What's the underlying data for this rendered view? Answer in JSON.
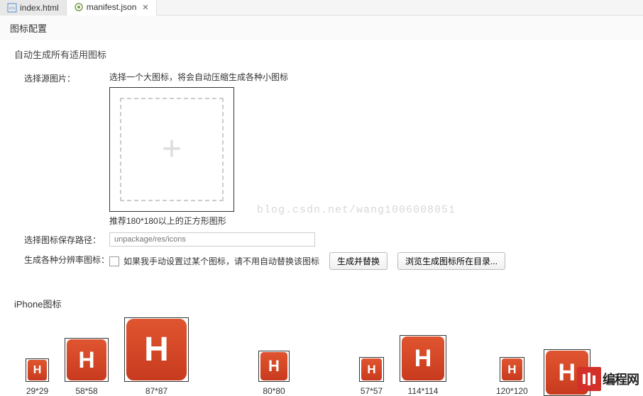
{
  "tabs": {
    "index": "index.html",
    "manifest": "manifest.json"
  },
  "section": {
    "title": "图标配置"
  },
  "group": {
    "autoGenerate": "自动生成所有适用图标"
  },
  "sourceImage": {
    "label": "选择源图片：",
    "hint": "选择一个大图标，将会自动压缩生成各种小图标",
    "recommend": "推荐180*180以上的正方形图形"
  },
  "watermark": "blog.csdn.net/wang1006008051",
  "savePath": {
    "label": "选择图标保存路径：",
    "placeholder": "unpackage/res/icons"
  },
  "generate": {
    "label": "生成各种分辨率图标：",
    "checkboxLabel": "如果我手动设置过某个图标，请不用自动替换该图标",
    "button": "生成并替换",
    "browseButton": "浏览生成图标所在目录..."
  },
  "iphone": {
    "title": "iPhone图标",
    "sizes": [
      "29*29",
      "58*58",
      "87*87",
      "80*80",
      "57*57",
      "114*114",
      "120*120"
    ]
  },
  "logo": {
    "text": "编程网"
  }
}
